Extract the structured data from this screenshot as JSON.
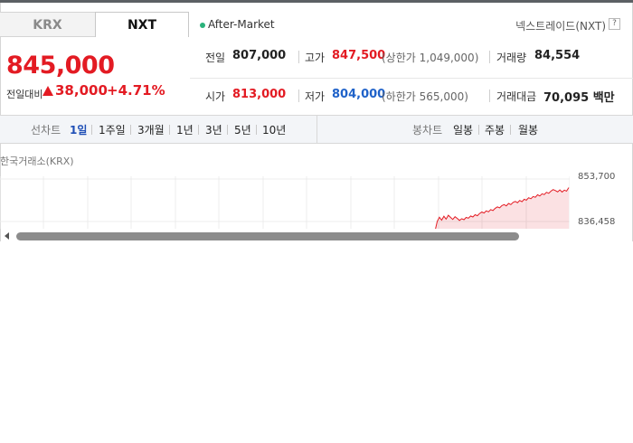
{
  "tabs": [
    {
      "label": "KRX",
      "active": false
    },
    {
      "label": "NXT",
      "active": true
    }
  ],
  "status": {
    "label": "After-Market",
    "dot_color": "#2ab27b"
  },
  "market_name": "넥스트레이드(NXT)",
  "info_icon": "?",
  "quote": {
    "price": "845,000",
    "change_label": "전일대비",
    "change_amount": "38,000",
    "change_pct": "+4.71%",
    "direction": "up",
    "up_color": "#e31b23",
    "down_color": "#1f62c9"
  },
  "stats": {
    "prev_close": {
      "label": "전일",
      "value": "807,000"
    },
    "high": {
      "label": "고가",
      "value": "847,500",
      "sub": "(상한가 1,049,000)"
    },
    "volume": {
      "label": "거래량",
      "value": "84,554"
    },
    "open": {
      "label": "시가",
      "value": "813,000"
    },
    "low": {
      "label": "저가",
      "value": "804,000",
      "sub": "(하한가 565,000)"
    },
    "amount": {
      "label": "거래대금",
      "value": "70,095 백만"
    }
  },
  "toolbar": {
    "line_chart_label": "선차트",
    "periods": [
      "1일",
      "1주일",
      "3개월",
      "1년",
      "3년",
      "5년",
      "10년"
    ],
    "active_period": "1일",
    "candle_chart_label": "봉차트",
    "candle_periods": [
      "일봉",
      "주봉",
      "월봉"
    ]
  },
  "chart": {
    "exchange_label": "한국거래소(KRX)",
    "y_high": "853,700",
    "y_low": "836,458"
  },
  "chart_data": {
    "type": "line",
    "title": "",
    "xlabel": "",
    "ylabel": "",
    "ylim": [
      836458,
      853700
    ],
    "y_ticks": [
      "853,700",
      "836,458"
    ],
    "series": [
      {
        "values": [
          832500,
          836500,
          838200,
          837000,
          838600,
          837400,
          839000,
          838100,
          837300,
          838400,
          837700,
          836900,
          837600,
          837200,
          838100,
          837800,
          838700,
          838300,
          839200,
          838800,
          839700,
          840300,
          839900,
          840800,
          840400,
          841300,
          840900,
          841800,
          842400,
          842000,
          842900,
          843300,
          842800,
          843800,
          843300,
          844200,
          844600,
          844100,
          845000,
          844500,
          845500,
          845100,
          846100,
          845700,
          846600,
          846300,
          847300,
          846800,
          847700,
          847400,
          848300,
          847900,
          848800,
          849400,
          849000,
          848500,
          849300,
          848400,
          849200,
          848800,
          850200
        ],
        "color": "#e31b23"
      }
    ],
    "grid": true
  }
}
